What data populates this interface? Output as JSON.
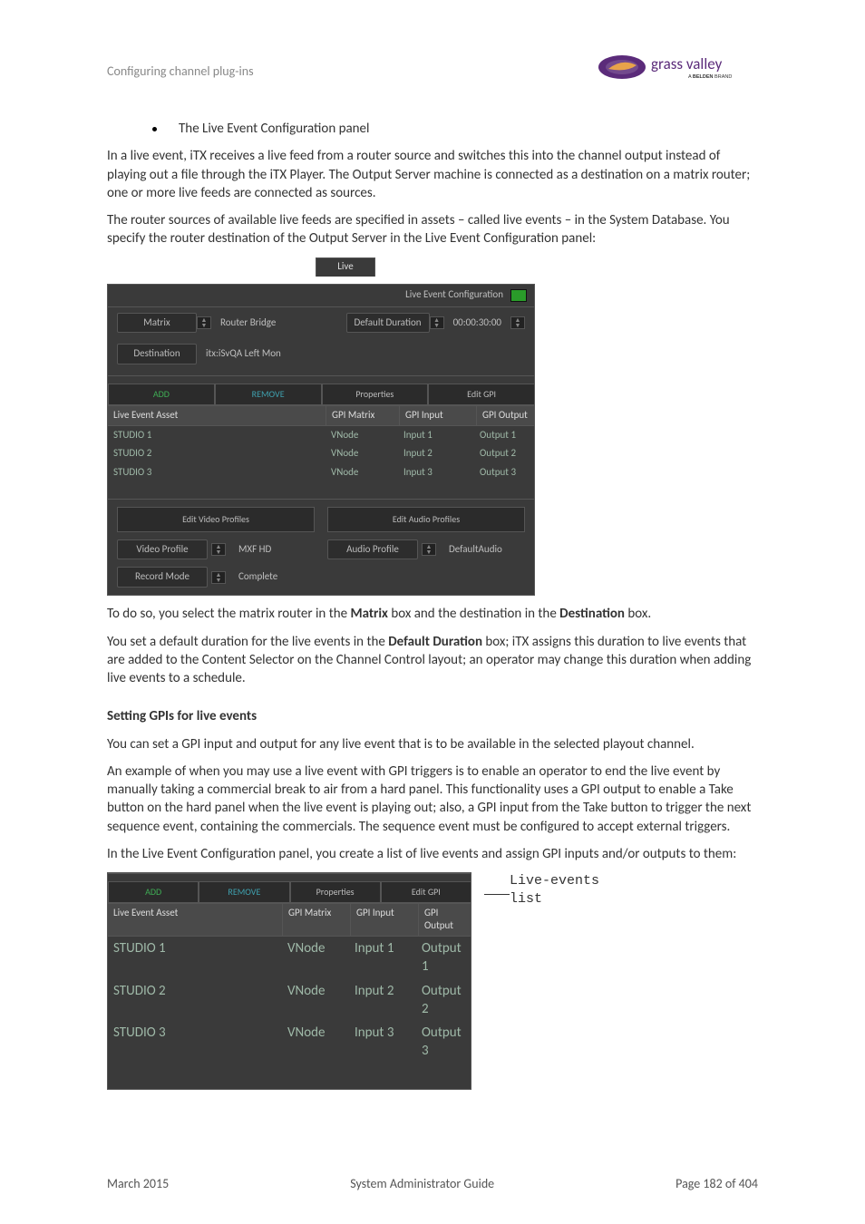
{
  "header": {
    "section": "Configuring channel plug-ins"
  },
  "logo": {
    "brand": "grass valley",
    "tagline_prefix": "A ",
    "tagline_bold": "BELDEN",
    "tagline_suffix": " BRAND"
  },
  "bullet": "The Live Event Configuration panel",
  "para1": "In a live event, iTX receives a live feed from a router source and switches this into the channel output instead of playing out a file through the iTX Player. The Output Server machine is connected as a destination on a matrix router; one or more live feeds are connected as sources.",
  "para2": "The router sources of available live feeds are specified in assets – called live events – in the System Database. You specify the router destination of the Output Server in the Live Event Configuration panel:",
  "panel": {
    "tab": "Live",
    "title": "Live Event Configuration",
    "matrix_label": "Matrix",
    "matrix_value": "Router Bridge",
    "dest_label": "Destination",
    "dest_value": "itx:iSvQA Left Mon",
    "dur_label": "Default Duration",
    "dur_value": "00:00:30:00",
    "btn_add": "ADD",
    "btn_remove": "REMOVE",
    "btn_props": "Properties",
    "btn_edit": "Edit GPI",
    "th": {
      "a": "Live Event Asset",
      "b": "GPI Matrix",
      "c": "GPI Input",
      "d": "GPI Output"
    },
    "rows": [
      {
        "a": "STUDIO 1",
        "b": "VNode",
        "c": "Input 1",
        "d": "Output 1"
      },
      {
        "a": "STUDIO 2",
        "b": "VNode",
        "c": "Input 2",
        "d": "Output 2"
      },
      {
        "a": "STUDIO 3",
        "b": "VNode",
        "c": "Input 3",
        "d": "Output 3"
      }
    ],
    "edit_video": "Edit Video Profiles",
    "edit_audio": "Edit Audio Profiles",
    "video_profile_label": "Video Profile",
    "video_profile_value": "MXF HD",
    "audio_profile_label": "Audio Profile",
    "audio_profile_value": "DefaultAudio",
    "record_mode_label": "Record Mode",
    "record_mode_value": "Complete"
  },
  "para3_a": "To do so, you select the matrix router in the ",
  "para3_b": "Matrix",
  "para3_c": " box and the destination in the ",
  "para3_d": "Destination",
  "para3_e": " box.",
  "para4_a": "You set a default duration for the live events in the ",
  "para4_b": "Default Duration",
  "para4_c": " box; iTX assigns this duration to live events that are added to the Content Selector on the Channel Control layout; an operator may change this duration when adding live events to a schedule.",
  "h_gpi": "Setting GPIs for live events",
  "para5": "You can set a GPI input and output for any live event that is to be available in the selected playout channel.",
  "para6": "An example of when you may use a live event with GPI triggers is to enable an operator to end the live event by manually taking a commercial break to air from a hard panel. This functionality uses a GPI output to enable a Take button on the hard panel when the live event is playing out; also, a GPI input from the Take button to trigger the next sequence event, containing the commercials. The sequence event must be configured to accept external triggers.",
  "para7": "In the Live Event Configuration panel, you create a list of live events and assign GPI inputs and/or outputs to them:",
  "annot1": "Live-events",
  "annot2": "list",
  "footer": {
    "left": "March 2015",
    "center": "System Administrator Guide",
    "right": "Page 182 of 404"
  }
}
